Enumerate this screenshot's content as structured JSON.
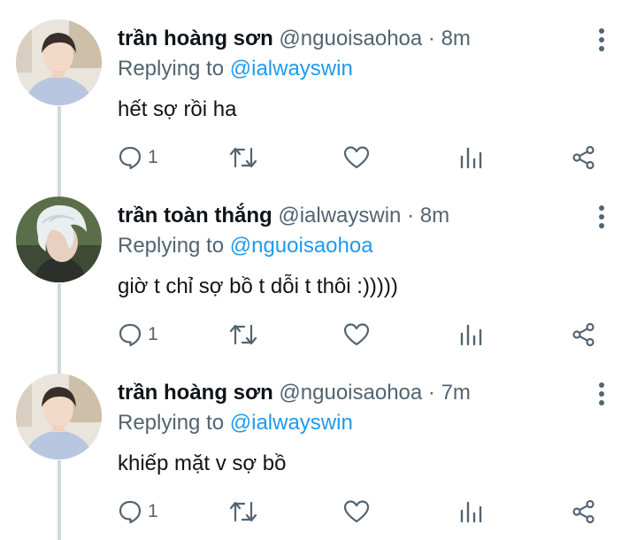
{
  "tweets": [
    {
      "name": "trần hoàng sơn",
      "handle": "@nguoisaohoa",
      "separator": "·",
      "time": "8m",
      "replying_prefix": "Replying to",
      "replying_to": "@ialwayswin",
      "text": "hết sợ rồi ha",
      "reply_count": "1",
      "avatar": "avatar-boy-hoodie"
    },
    {
      "name": "trần toàn thắng",
      "handle": "@ialwayswin",
      "separator": "·",
      "time": "8m",
      "replying_prefix": "Replying to",
      "replying_to": "@nguoisaohoa",
      "text": "giờ t chỉ sợ bồ t dỗi t thôi :)))))",
      "reply_count": "1",
      "avatar": "avatar-white-hair"
    },
    {
      "name": "trần hoàng sơn",
      "handle": "@nguoisaohoa",
      "separator": "·",
      "time": "7m",
      "replying_prefix": "Replying to",
      "replying_to": "@ialwayswin",
      "text": "khiếp mặt v sợ bồ",
      "reply_count": "1",
      "avatar": "avatar-boy-hoodie"
    }
  ],
  "icons": {
    "more": "more-vertical-icon",
    "reply": "reply-icon",
    "retweet": "retweet-icon",
    "like": "heart-icon",
    "views": "views-icon",
    "share": "share-icon"
  },
  "colors": {
    "text": "#0f1419",
    "secondary": "#536471",
    "link": "#1d9bf0",
    "thread_line": "#cfd9de"
  }
}
